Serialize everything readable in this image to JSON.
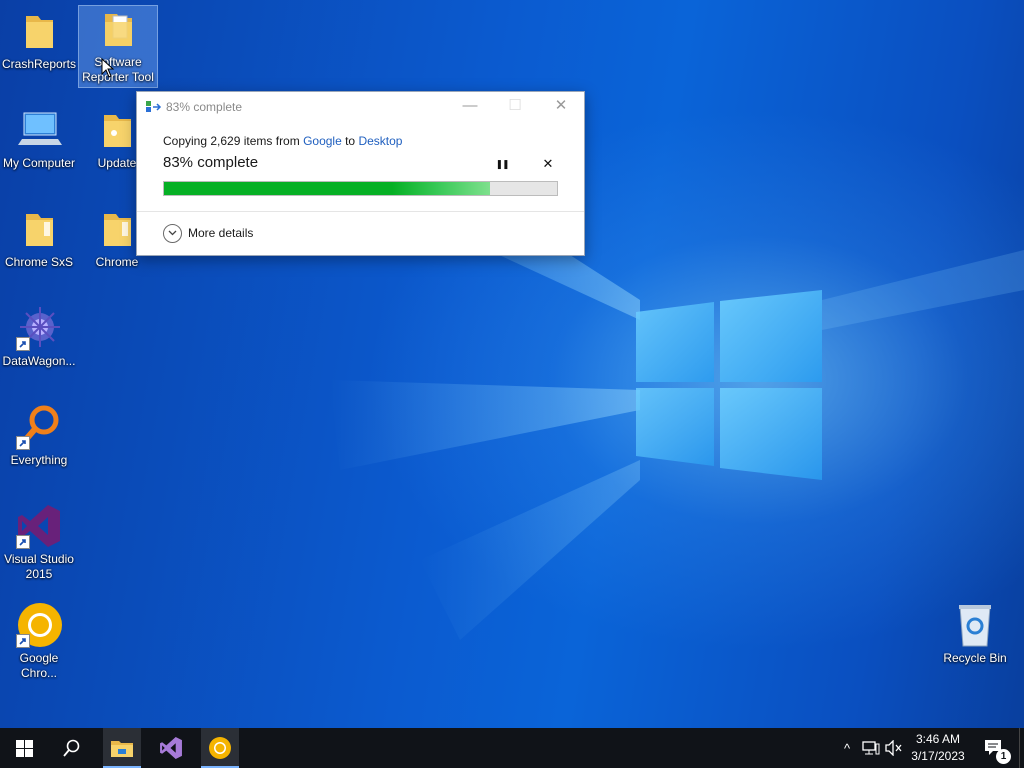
{
  "desktop": {
    "icons": [
      {
        "id": "crashreports",
        "label": "CrashReports",
        "icon": "folder-icon"
      },
      {
        "id": "software-reporter",
        "label": "Software Reporter Tool",
        "icon": "folder-icon",
        "selected": true
      },
      {
        "id": "my-computer",
        "label": "My Computer",
        "icon": "computer-icon"
      },
      {
        "id": "update",
        "label": "Update",
        "icon": "folder-icon"
      },
      {
        "id": "chrome-sxs",
        "label": "Chrome SxS",
        "icon": "folder-icon"
      },
      {
        "id": "chrome-folder",
        "label": "Chrome",
        "icon": "folder-icon"
      },
      {
        "id": "datawagon",
        "label": "DataWagon...",
        "icon": "datawagon-icon"
      },
      {
        "id": "everything",
        "label": "Everything",
        "icon": "magnifier-icon"
      },
      {
        "id": "visual-studio",
        "label": "Visual Studio 2015",
        "icon": "visual-studio-icon"
      },
      {
        "id": "google-chrome",
        "label": "Google Chro...",
        "icon": "chrome-canary-icon"
      },
      {
        "id": "recycle-bin",
        "label": "Recycle Bin",
        "icon": "recycle-bin-icon"
      }
    ]
  },
  "dialog": {
    "title": "83% complete",
    "copy_prefix": "Copying 2,629 items from ",
    "source": "Google",
    "to_word": " to ",
    "destination": "Desktop",
    "percent_text": "83% complete",
    "progress_fraction": 0.83,
    "pause_glyph": "❚❚",
    "cancel_glyph": "✕",
    "more_details": "More details",
    "titlebar_buttons": {
      "minimize": "—",
      "maximize": "☐",
      "close": "✕"
    }
  },
  "taskbar": {
    "start": "start-icon",
    "search": "search-icon",
    "pinned": [
      "file-explorer-icon",
      "visual-studio-icon",
      "chrome-canary-icon"
    ],
    "tray": {
      "chevron": "^",
      "time": "3:46 AM",
      "date": "3/17/2023",
      "notification_count": "1"
    }
  },
  "colors": {
    "progress": "#06b025",
    "link": "#1f5fbf",
    "taskbar": "#101318"
  }
}
